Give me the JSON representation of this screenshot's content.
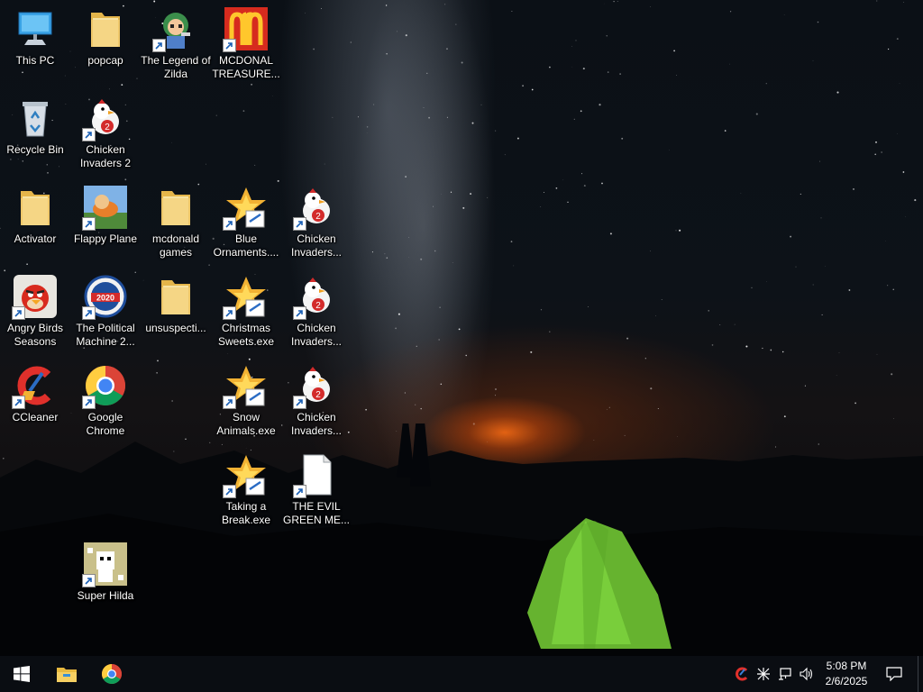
{
  "desktop": {
    "icons": [
      {
        "label": "This PC",
        "icon": "computer-icon",
        "shortcut": false
      },
      {
        "label": "popcap",
        "icon": "folder-icon",
        "shortcut": false
      },
      {
        "label": "The Legend of Zilda",
        "icon": "game-character-icon",
        "shortcut": true
      },
      {
        "label": "MCDONAL TREASURE...",
        "icon": "mcdonalds-logo-icon",
        "shortcut": true
      },
      {
        "label": "Recycle Bin",
        "icon": "recycle-bin-icon",
        "shortcut": false
      },
      {
        "label": "Chicken Invaders 2",
        "icon": "chicken-icon",
        "shortcut": true
      },
      {
        "label": "Activator",
        "icon": "folder-icon",
        "shortcut": false
      },
      {
        "label": "Flappy Plane",
        "icon": "game-thumbnail-icon",
        "shortcut": true
      },
      {
        "label": "mcdonald games",
        "icon": "folder-icon",
        "shortcut": false
      },
      {
        "label": "Blue Ornaments....",
        "icon": "popcap-exe-icon",
        "shortcut": true
      },
      {
        "label": "Chicken Invaders...",
        "icon": "chicken-icon",
        "shortcut": true
      },
      {
        "label": "Angry Birds Seasons",
        "icon": "angry-bird-icon",
        "shortcut": true
      },
      {
        "label": "The Political Machine 2...",
        "icon": "political-badge-icon",
        "shortcut": true
      },
      {
        "label": "unsuspecti...",
        "icon": "folder-icon",
        "shortcut": false
      },
      {
        "label": "Christmas Sweets.exe",
        "icon": "popcap-exe-icon",
        "shortcut": true
      },
      {
        "label": "Chicken Invaders...",
        "icon": "chicken-icon",
        "shortcut": true
      },
      {
        "label": "CCleaner",
        "icon": "ccleaner-icon",
        "shortcut": true
      },
      {
        "label": "Google Chrome",
        "icon": "chrome-icon",
        "shortcut": true
      },
      {
        "label": "Snow Animals.exe",
        "icon": "popcap-exe-icon",
        "shortcut": true
      },
      {
        "label": "Chicken Invaders...",
        "icon": "chicken-icon",
        "shortcut": true
      },
      {
        "label": "Taking a Break.exe",
        "icon": "popcap-exe-icon",
        "shortcut": true
      },
      {
        "label": "THE EVIL GREEN ME...",
        "icon": "blank-file-icon",
        "shortcut": true
      },
      {
        "label": "Super Hilda",
        "icon": "pixel-game-icon",
        "shortcut": true
      }
    ]
  },
  "taskbar": {
    "start_icon": "windows-logo-icon",
    "pinned": [
      {
        "name": "file-explorer",
        "icon": "folder-icon"
      },
      {
        "name": "google-chrome",
        "icon": "chrome-icon"
      }
    ],
    "tray_icons": [
      "ccleaner-tray-icon",
      "bluetooth-icon",
      "network-icon",
      "volume-icon"
    ],
    "clock": {
      "time": "5:08 PM",
      "date": "2/6/2025"
    },
    "notification_icon": "action-center-icon"
  },
  "colors": {
    "taskbar": "#0a0d12",
    "horizon_glow": "#ff6e14",
    "tent": "#7cd63a",
    "label_text": "#ffffff"
  }
}
